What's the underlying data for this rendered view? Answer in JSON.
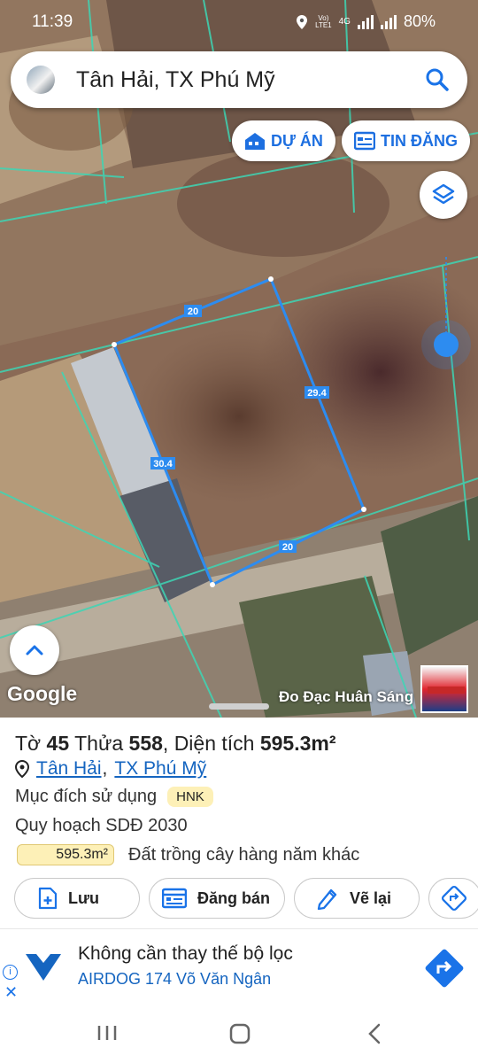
{
  "status": {
    "time": "11:39",
    "net_top": "Vo)",
    "net_bottom": "LTE1",
    "gen": "4G",
    "battery": "80%"
  },
  "search": {
    "title": "Tân Hải, TX Phú Mỹ"
  },
  "pills": {
    "project": "DỰ ÁN",
    "listing": "TIN ĐĂNG"
  },
  "map": {
    "edges": {
      "top": "20",
      "right": "29.4",
      "left": "30.4",
      "bottom": "20"
    },
    "attribution": "Đo Đạc Huân Sáng",
    "google": "Google"
  },
  "parcel": {
    "sheet_label": "Tờ",
    "sheet_no": "45",
    "plot_label": "Thửa",
    "plot_no": "558",
    "area_label": "Diện tích",
    "area": "595.3m²",
    "sep": ",",
    "ward": "Tân Hải",
    "town": "TX Phú Mỹ",
    "purpose_label": "Mục đích sử dụng",
    "purpose_code": "HNK",
    "plan_label": "Quy hoạch SDĐ 2030",
    "plan_area": "595.3m²",
    "plan_desc": "Đất trồng cây hàng năm khác",
    "plan_fill": 1.0
  },
  "actions": {
    "save": "Lưu",
    "post": "Đăng bán",
    "redraw": "Vẽ lại"
  },
  "ad": {
    "headline": "Không cần thay thế bộ lọc",
    "sub": "AIRDOG 174 Võ Văn Ngân",
    "info": "i",
    "close": "✕"
  },
  "colors": {
    "accent": "#1a73e8",
    "boundary": "#2d8cf0",
    "cadastral": "#3dd6b5",
    "badge_bg": "#fdf0b7"
  }
}
